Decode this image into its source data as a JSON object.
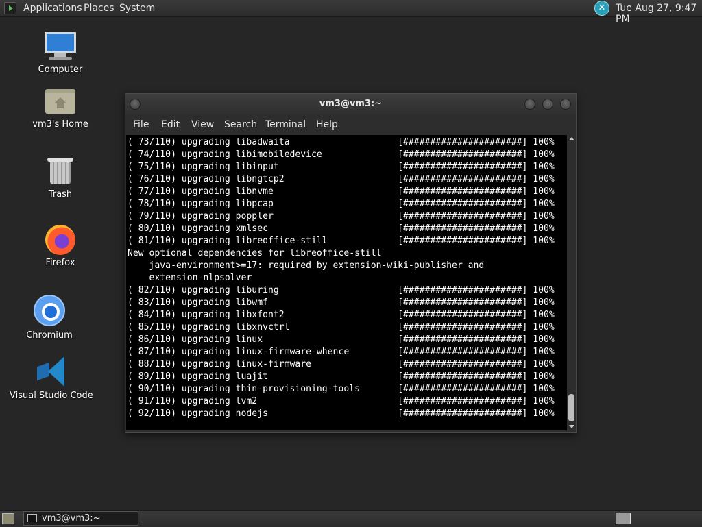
{
  "top_panel": {
    "menus": [
      "Applications",
      "Places",
      "System"
    ],
    "clock": "Tue Aug 27,  9:47 PM"
  },
  "desktop": {
    "icons": [
      {
        "label": "Computer"
      },
      {
        "label": "vm3's Home"
      },
      {
        "label": "Trash"
      },
      {
        "label": "Firefox"
      },
      {
        "label": "Chromium"
      },
      {
        "label": "Visual Studio Code"
      }
    ]
  },
  "terminal": {
    "title": "vm3@vm3:~",
    "menus": [
      "File",
      "Edit",
      "View",
      "Search",
      "Terminal",
      "Help"
    ],
    "lines": [
      "( 73/110) upgrading libadwaita                    [######################] 100%",
      "( 74/110) upgrading libimobiledevice              [######################] 100%",
      "( 75/110) upgrading libinput                      [######################] 100%",
      "( 76/110) upgrading libngtcp2                     [######################] 100%",
      "( 77/110) upgrading libnvme                       [######################] 100%",
      "( 78/110) upgrading libpcap                       [######################] 100%",
      "( 79/110) upgrading poppler                       [######################] 100%",
      "( 80/110) upgrading xmlsec                        [######################] 100%",
      "( 81/110) upgrading libreoffice-still             [######################] 100%",
      "New optional dependencies for libreoffice-still",
      "    java-environment>=17: required by extension-wiki-publisher and",
      "    extension-nlpsolver",
      "( 82/110) upgrading liburing                      [######################] 100%",
      "( 83/110) upgrading libwmf                        [######################] 100%",
      "( 84/110) upgrading libxfont2                     [######################] 100%",
      "( 85/110) upgrading libxnvctrl                    [######################] 100%",
      "( 86/110) upgrading linux                         [######################] 100%",
      "( 87/110) upgrading linux-firmware-whence         [######################] 100%",
      "( 88/110) upgrading linux-firmware                [######################] 100%",
      "( 89/110) upgrading luajit                        [######################] 100%",
      "( 90/110) upgrading thin-provisioning-tools       [######################] 100%",
      "( 91/110) upgrading lvm2                          [######################] 100%",
      "( 92/110) upgrading nodejs                        [######################] 100%"
    ]
  },
  "taskbar": {
    "window_label": "vm3@vm3:~"
  }
}
